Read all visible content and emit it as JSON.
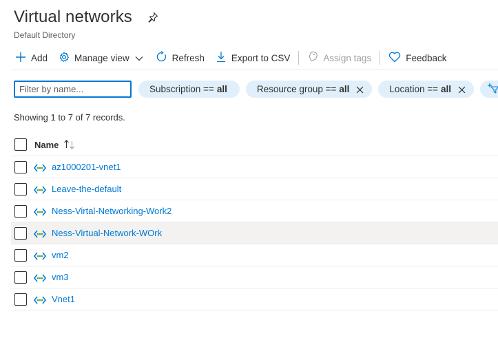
{
  "header": {
    "title": "Virtual networks",
    "subtitle": "Default Directory"
  },
  "toolbar": {
    "add_label": "Add",
    "manage_view_label": "Manage view",
    "refresh_label": "Refresh",
    "export_label": "Export to CSV",
    "assign_tags_label": "Assign tags",
    "feedback_label": "Feedback"
  },
  "filters": {
    "search_placeholder": "Filter by name...",
    "pills": [
      {
        "field": "Subscription ==",
        "value": "all"
      },
      {
        "field": "Resource group ==",
        "value": "all"
      },
      {
        "field": "Location ==",
        "value": "all"
      }
    ],
    "add_filter_label": "A"
  },
  "records_text": "Showing 1 to 7 of 7 records.",
  "table": {
    "column_name": "Name",
    "rows": [
      "az1000201-vnet1",
      "Leave-the-default",
      "Ness-Virtal-Networking-Work2",
      "Ness-Virtual-Network-WOrk",
      "vm2",
      "vm3",
      "Vnet1"
    ]
  },
  "colors": {
    "accent": "#0078d4",
    "pill_bg": "#e1effa",
    "vnet_icon_green": "#4aa63a",
    "row_hover": "#f3f2f1"
  }
}
